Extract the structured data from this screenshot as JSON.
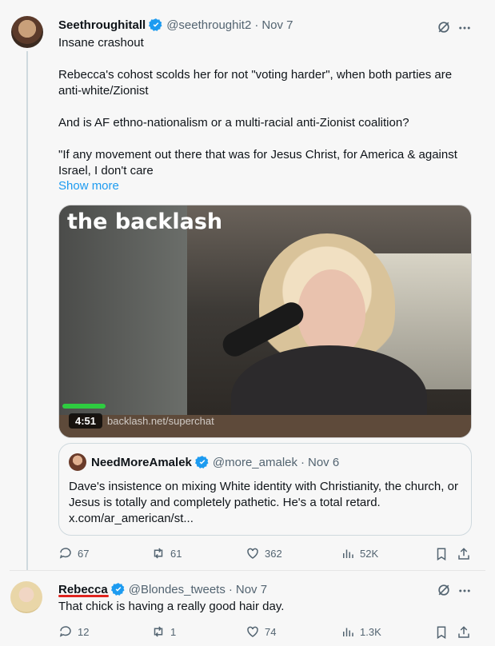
{
  "tweet1": {
    "name": "Seethroughitall",
    "handle": "@seethroughit2",
    "dot": "·",
    "date": "Nov 7",
    "paragraphs": [
      "Insane crashout",
      "Rebecca's cohost scolds her for not \"voting harder\", when both parties are anti-white/Zionist",
      "And is AF ethno-nationalism or a multi-racial anti-Zionist coalition?",
      "\"If any movement out there that was for Jesus Christ, for America & against Israel, I don't care"
    ],
    "show_more": "Show more",
    "video": {
      "overlay_text": "the backlash",
      "duration": "4:51",
      "url_overlay": "backlash.net/superchat"
    },
    "quote": {
      "name": "NeedMoreAmalek",
      "handle": "@more_amalek",
      "dot": "·",
      "date": "Nov 6",
      "text": "Dave's insistence on mixing White identity with Christianity, the church, or Jesus is totally and completely pathetic. He's a total retard. x.com/ar_american/st..."
    },
    "actions": {
      "replies": "67",
      "reposts": "61",
      "likes": "362",
      "views": "52K"
    }
  },
  "tweet2": {
    "name": "Rebecca",
    "handle": "@Blondes_tweets",
    "dot": "·",
    "date": "Nov 7",
    "text": "That chick is having a really good hair day.",
    "actions": {
      "replies": "12",
      "reposts": "1",
      "likes": "74",
      "views": "1.3K"
    }
  },
  "colors": {
    "accent": "#1d9bf0",
    "muted": "#536471",
    "underline": "#e0241e"
  }
}
